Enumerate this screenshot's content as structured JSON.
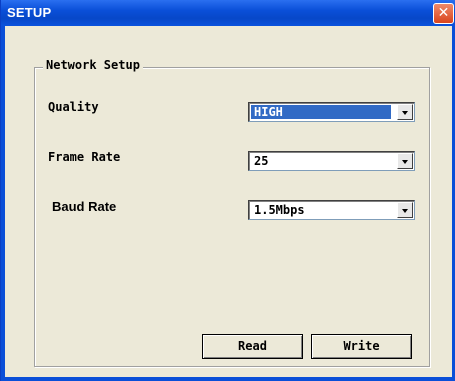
{
  "window": {
    "title": "SETUP",
    "close_glyph": "✕",
    "titlebar_color": "#0a4fd8",
    "background_color": "#ece9d8"
  },
  "group": {
    "title": "Network Setup"
  },
  "fields": {
    "quality": {
      "label": "Quality",
      "value": "HIGH",
      "focused": true
    },
    "frame_rate": {
      "label": "Frame Rate",
      "value": "25"
    },
    "baud_rate": {
      "label": "Baud Rate",
      "value": "1.5Mbps"
    }
  },
  "buttons": {
    "read": "Read",
    "write": "Write"
  },
  "icons": {
    "close": "close-icon",
    "dropdown": "chevron-down-icon"
  }
}
